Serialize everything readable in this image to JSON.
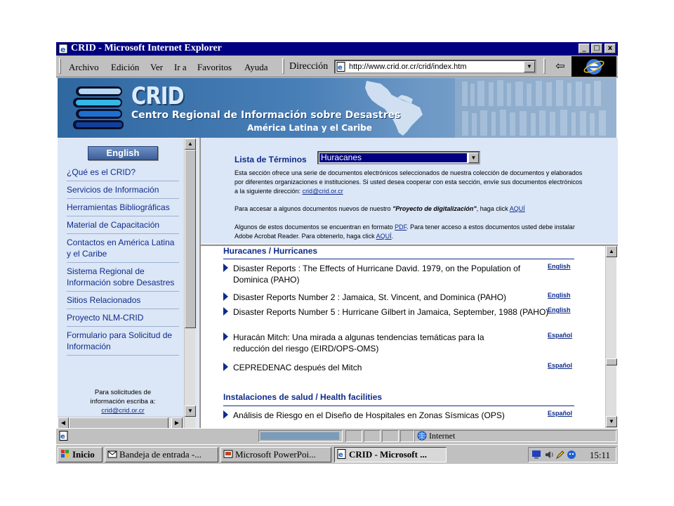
{
  "window": {
    "title": "CRID - Microsoft Internet Explorer",
    "minimize": "_",
    "maximize": "□",
    "close": "x"
  },
  "menu": {
    "items": [
      "Archivo",
      "Edición",
      "Ver",
      "Ir a",
      "Favoritos",
      "Ayuda"
    ],
    "address_label": "Dirección",
    "url": "http://www.crid.or.cr/crid/index.htm"
  },
  "banner": {
    "logo": "CRID",
    "subtitle": "Centro Regional de Información sobre Desastres",
    "region": "América Latina  y el Caribe"
  },
  "left_nav": {
    "english_button": "English",
    "items": [
      "¿Qué es el CRID?",
      "Servicios de Información",
      "Herramientas Bibliográficas",
      "Material de Capacitación",
      "Contactos en América Latina y el Caribe",
      "Sistema Regional de Información sobre Desastres",
      "Sitios Relacionados",
      "Proyecto NLM-CRID",
      "Formulario para Solicitud de Información"
    ],
    "request_line1": "Para solicitudes de",
    "request_line2": "información escriba a:",
    "request_email": "crid@crid.or.cr"
  },
  "top_frame": {
    "lista_label": "Lista de Términos",
    "lista_selected": "Huracanes",
    "intro_text": "Esta sección ofrece una serie de documentos electrónicos seleccionados de nuestra colección de documentos y elaborados por diferentes organizaciones e instituciones. Si usted desea cooperar con esta sección, envíe sus documentos electrónicos a la siguiente dirección: ",
    "intro_email": "crid@crid.or.cr",
    "p2_text": "Para accesar a algunos documentos nuevos de nuestro ",
    "p2_project": "\"Proyecto de digitalización\"",
    "p2_tail": ", haga click ",
    "p2_link": "AQUÍ",
    "p3_a": "Algunos de estos documentos se encuentran en formato ",
    "p3_pdf": "PDF",
    "p3_b": ". Para tener acceso a estos documentos usted debe instalar Adobe Acrobat Reader. Para obtenerlo, haga click ",
    "p3_link": "AQUÍ",
    "p3_end": "."
  },
  "documents": {
    "section1": "Huracanes / Hurricanes",
    "items": [
      {
        "title": "Disaster Reports : The Effects of Hurricane David. 1979, on the Population of Dominica (PAHO)",
        "lang": "English"
      },
      {
        "title": "Disaster Reports Number 2 : Jamaica, St. Vincent, and Dominica (PAHO)",
        "lang": "English"
      },
      {
        "title": "Disaster Reports Number 5 : Hurricane Gilbert in Jamaica, September, 1988 (PAHO)",
        "lang": "English"
      },
      {
        "title": "Huracán Mitch: Una mirada a algunas tendencias temáticas para la reducción del riesgo (EIRD/OPS-OMS)",
        "lang": "Español"
      },
      {
        "title": "CEPREDENAC después del Mitch",
        "lang": "Español"
      }
    ],
    "section2": "Instalaciones de salud / Health facilities",
    "items2": [
      {
        "title": "Análisis de Riesgo en el Diseño de Hospitales en Zonas Sísmicas (OPS)",
        "lang": "Español"
      }
    ]
  },
  "statusbar": {
    "zone": "Internet"
  },
  "taskbar": {
    "start": "Inicio",
    "tasks": [
      "Bandeja de entrada -...",
      "Microsoft PowerPoi...",
      "CRID - Microsoft ..."
    ],
    "clock": "15:11"
  }
}
